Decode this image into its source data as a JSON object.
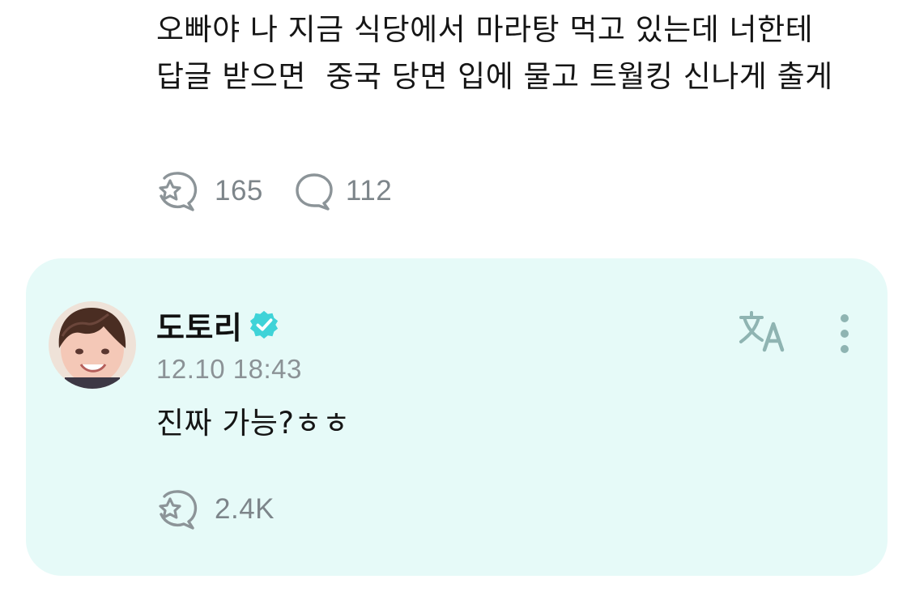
{
  "post": {
    "text": "오빠야 나 지금 식당에서 마라탕 먹고 있는데 너한테 답글 받으면  중국 당면 입에 물고 트월킹 신나게 출게",
    "like_count": "165",
    "comment_count": "112"
  },
  "reply": {
    "author_name": "도토리",
    "timestamp": "12.10 18:43",
    "text": "진짜 가능?ㅎㅎ",
    "like_count": "2.4K"
  },
  "icons": {
    "like": "bubble-star-icon",
    "comment": "comment-bubble-icon",
    "verified": "verified-badge-icon",
    "translate": "translate-icon",
    "more": "more-vertical-icon"
  },
  "colors": {
    "card_background": "#e6faf8",
    "verified": "#3fd3d8",
    "icon_gray": "#8c9498",
    "muted_text": "#8b9296",
    "translate": "#8fb4b2"
  }
}
